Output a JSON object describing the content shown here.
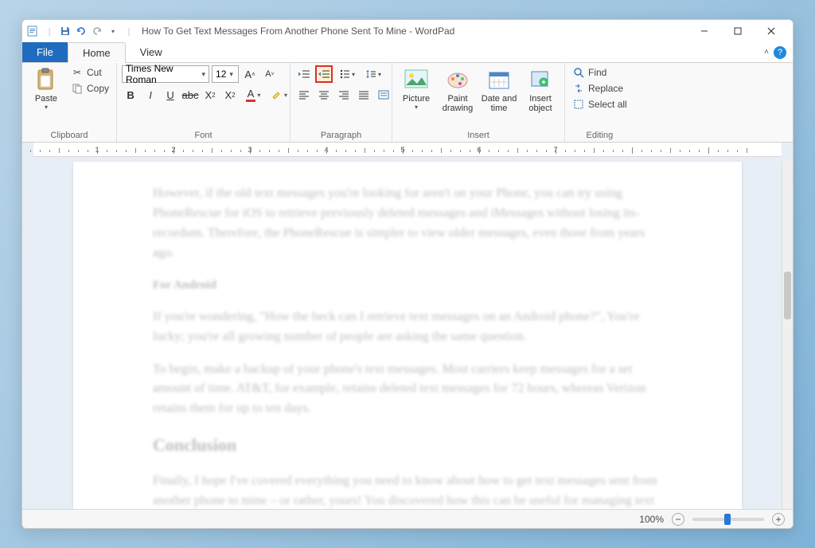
{
  "window": {
    "title": "How To Get Text Messages From Another Phone Sent To Mine - WordPad"
  },
  "tabs": {
    "file": "File",
    "home": "Home",
    "view": "View"
  },
  "clipboard": {
    "paste": "Paste",
    "cut": "Cut",
    "copy": "Copy",
    "label": "Clipboard"
  },
  "font": {
    "name": "Times New Roman",
    "size": "12",
    "label": "Font"
  },
  "paragraph": {
    "label": "Paragraph"
  },
  "insert": {
    "picture": "Picture",
    "paint": "Paint drawing",
    "datetime": "Date and time",
    "object": "Insert object",
    "label": "Insert"
  },
  "editing": {
    "find": "Find",
    "replace": "Replace",
    "selectall": "Select all",
    "label": "Editing"
  },
  "status": {
    "zoom": "100%"
  },
  "ruler": {
    "marks": [
      "1",
      "2",
      "3",
      "4",
      "5",
      "6",
      "7"
    ]
  }
}
